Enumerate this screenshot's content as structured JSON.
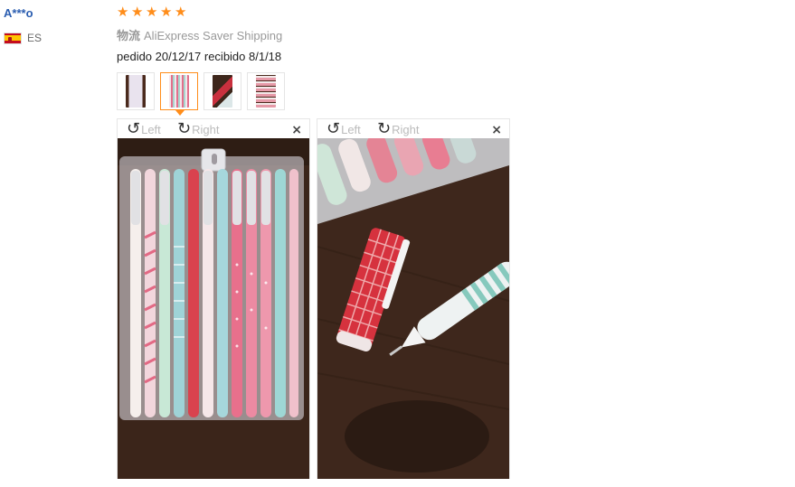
{
  "review": {
    "user": "A***o",
    "country": "ES",
    "rating_label": "5 stars",
    "shipping_label": "物流",
    "shipping_method": "AliExpress Saver Shipping",
    "order_dates": "pedido 20/12/17 recibido 8/1/18"
  },
  "rating": {
    "stars": 5,
    "max": 5,
    "color": "#ff8d1a"
  },
  "thumbnails": [
    {
      "icon": "photo-thumbnail",
      "active": false
    },
    {
      "icon": "photo-thumbnail",
      "active": true
    },
    {
      "icon": "photo-thumbnail",
      "active": false
    },
    {
      "icon": "photo-thumbnail",
      "active": false
    }
  ],
  "viewers": [
    {
      "rotate_left": "Left",
      "rotate_right": "Right",
      "close": "×"
    },
    {
      "rotate_left": "Left",
      "rotate_right": "Right",
      "close": "×"
    }
  ],
  "colors": {
    "username": "#2a5db0",
    "accent": "#ff8d1a"
  }
}
